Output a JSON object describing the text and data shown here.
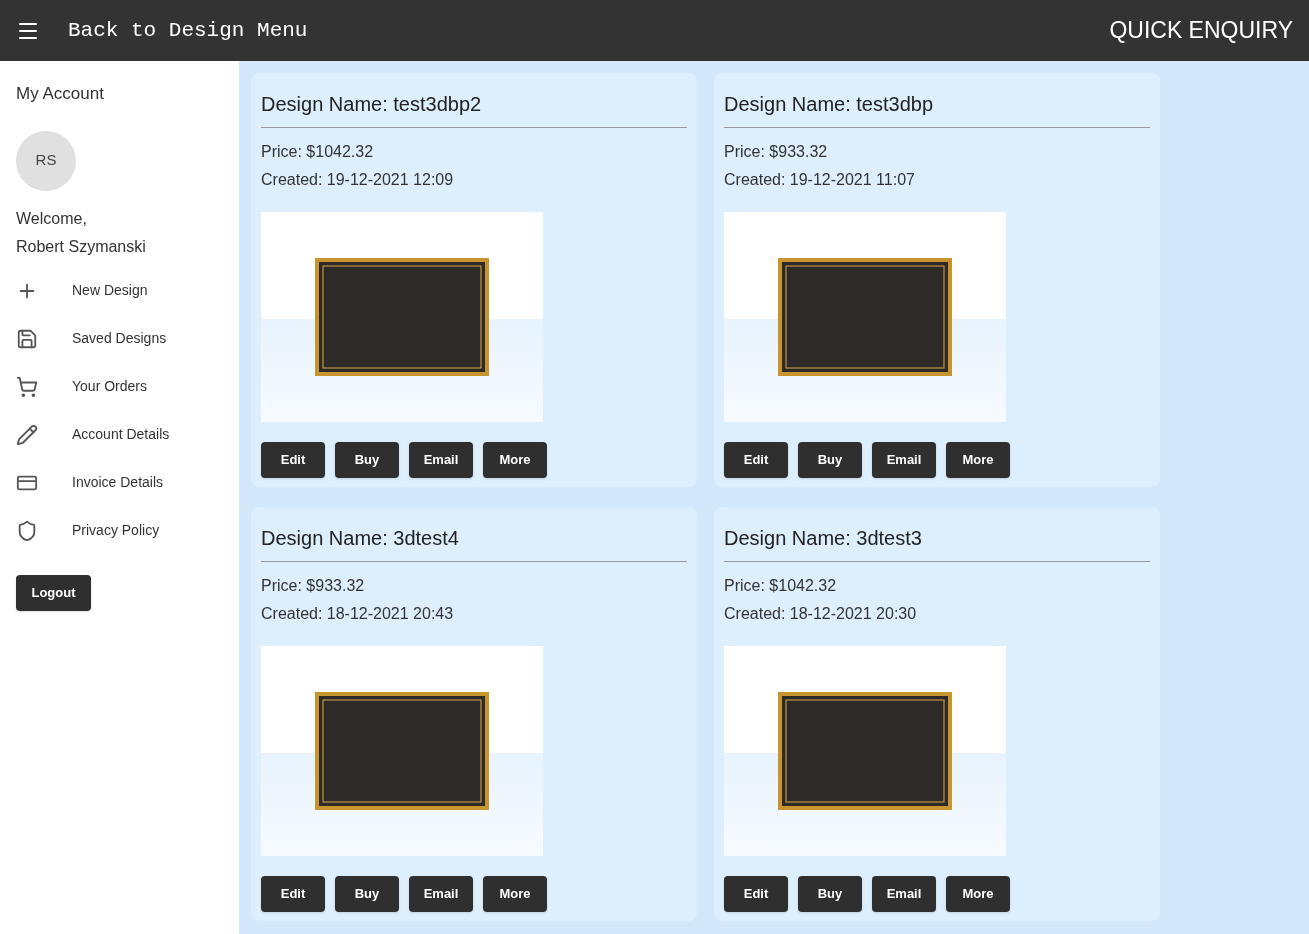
{
  "header": {
    "title": "Back to Design Menu",
    "action": "QUICK ENQUIRY"
  },
  "sidebar": {
    "heading": "My Account",
    "avatar": "RS",
    "welcome": "Welcome,",
    "user": "Robert Szymanski",
    "items": [
      {
        "label": "New Design",
        "kind": "plus"
      },
      {
        "label": "Saved Designs",
        "kind": "save"
      },
      {
        "label": "Your Orders",
        "kind": "cart"
      },
      {
        "label": "Account Details",
        "kind": "pencil"
      },
      {
        "label": "Invoice Details",
        "kind": "card"
      },
      {
        "label": "Privacy Policy",
        "kind": "shield"
      }
    ],
    "logout": "Logout"
  },
  "designs": [
    {
      "name": "Design Name: test3dbp2",
      "price": "Price: $1042.32",
      "created": "Created: 19-12-2021 12:09",
      "actions": [
        "Edit",
        "Buy",
        "Email",
        "More"
      ]
    },
    {
      "name": "Design Name: test3dbp",
      "price": "Price: $933.32",
      "created": "Created: 19-12-2021 11:07",
      "actions": [
        "Edit",
        "Buy",
        "Email",
        "More"
      ]
    },
    {
      "name": "Design Name: 3dtest4",
      "price": "Price: $933.32",
      "created": "Created: 18-12-2021 20:43",
      "actions": [
        "Edit",
        "Buy",
        "Email",
        "More"
      ]
    },
    {
      "name": "Design Name: 3dtest3",
      "price": "Price: $1042.32",
      "created": "Created: 18-12-2021 20:30",
      "actions": [
        "Edit",
        "Buy",
        "Email",
        "More"
      ]
    }
  ]
}
